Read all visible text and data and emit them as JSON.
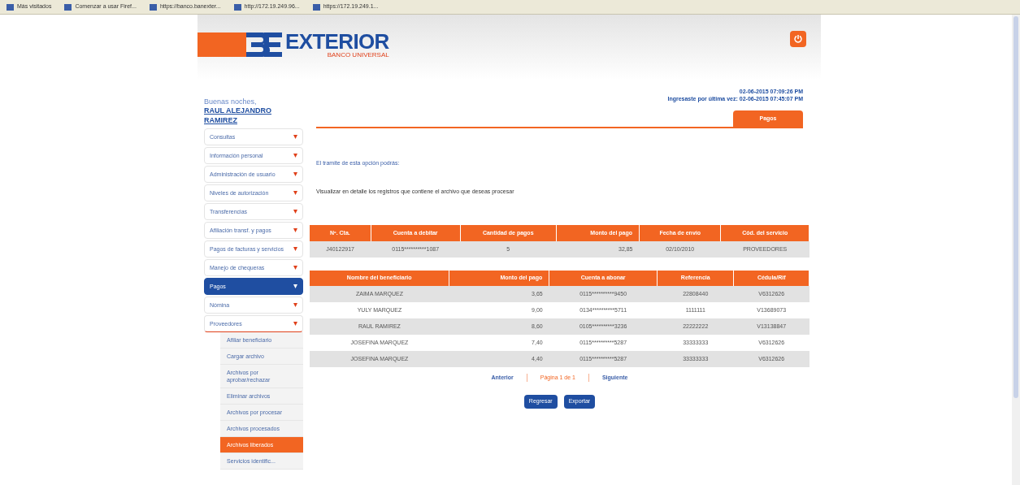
{
  "bookmarks": [
    "Más visitados",
    "Comenzar a usar Firef...",
    "https://banco.banexter...",
    "http://172.19.249.96...",
    "https://172.19.249.1..."
  ],
  "logo": {
    "name": "EXTERIOR",
    "tagline": "BANCO UNIVERSAL"
  },
  "greeting": {
    "salutation": "Buenas noches,",
    "user": "RAUL ALEJANDRO RAMIREZ"
  },
  "menu": [
    {
      "label": "Consultas",
      "selected": false,
      "expanded": false
    },
    {
      "label": "Información personal",
      "selected": false,
      "expanded": false
    },
    {
      "label": "Administración de usuario",
      "selected": false,
      "expanded": false
    },
    {
      "label": "Niveles de autorización",
      "selected": false,
      "expanded": false
    },
    {
      "label": "Transferencias",
      "selected": false,
      "expanded": false
    },
    {
      "label": "Afiliación transf. y pagos",
      "selected": false,
      "expanded": false
    },
    {
      "label": "Pagos de facturas y servicios",
      "selected": false,
      "expanded": false
    },
    {
      "label": "Manejo de chequeras",
      "selected": false,
      "expanded": false
    },
    {
      "label": "Pagos",
      "selected": true,
      "expanded": false
    },
    {
      "label": "Nómina",
      "selected": false,
      "expanded": false
    },
    {
      "label": "Proveedores",
      "selected": false,
      "expanded": true,
      "children": [
        {
          "label": "Afiliar beneficiario",
          "selected": false
        },
        {
          "label": "Cargar archivo",
          "selected": false
        },
        {
          "label": "Archivos por aprobar/rechazar",
          "selected": false
        },
        {
          "label": "Eliminar archivos",
          "selected": false
        },
        {
          "label": "Archivos por procesar",
          "selected": false
        },
        {
          "label": "Archivos procesados",
          "selected": false
        },
        {
          "label": "Archivos liberados",
          "selected": true
        },
        {
          "label": "Servicios identific...",
          "selected": false
        }
      ]
    }
  ],
  "session": {
    "now": "02-06-2015 07:09:26 PM",
    "last_login_label": "Ingresaste por última vez:",
    "last_login": "02-06-2015 07:45:07 PM"
  },
  "tabs": [
    {
      "label": "Pagos",
      "selected": true
    }
  ],
  "intro": "El tramite de esta opción podrás:",
  "instruction": "Visualizar en detalle los registros que contiene el archivo que deseas procesar",
  "summary_table": {
    "columns": [
      "Nº. Cta.",
      "Cuenta a debitar",
      "Cantidad de pagos",
      "Monto del pago",
      "Fecha de envío",
      "Cód. del servicio"
    ],
    "rows": [
      [
        "J40122917",
        "0115**********1087",
        "5",
        "32,85",
        "02/10/2010",
        "PROVEEDORES"
      ]
    ]
  },
  "detail_table": {
    "columns": [
      "Nombre del beneficiario",
      "Monto del pago",
      "Cuenta a abonar",
      "Referencia",
      "Cédula/Rif"
    ],
    "rows": [
      [
        "ZAIMA MARQUEZ",
        "3,65",
        "0115**********9450",
        "22808440",
        "V6312626"
      ],
      [
        "YULY MARQUEZ",
        "9,00",
        "0134**********5711",
        "1111111",
        "V13689073"
      ],
      [
        "RAUL RAMIREZ",
        "8,60",
        "0105**********3236",
        "22222222",
        "V13138847"
      ],
      [
        "JOSEFINA MARQUEZ",
        "7,40",
        "0115**********5287",
        "33333333",
        "V6312626"
      ],
      [
        "JOSEFINA MARQUEZ",
        "4,40",
        "0115**********5287",
        "33333333",
        "V6312626"
      ]
    ]
  },
  "pagination": {
    "previous": "Anterior",
    "page": "Página 1 de 1",
    "next": "Siguiente"
  },
  "buttons": [
    "Regresar",
    "Exportar"
  ]
}
